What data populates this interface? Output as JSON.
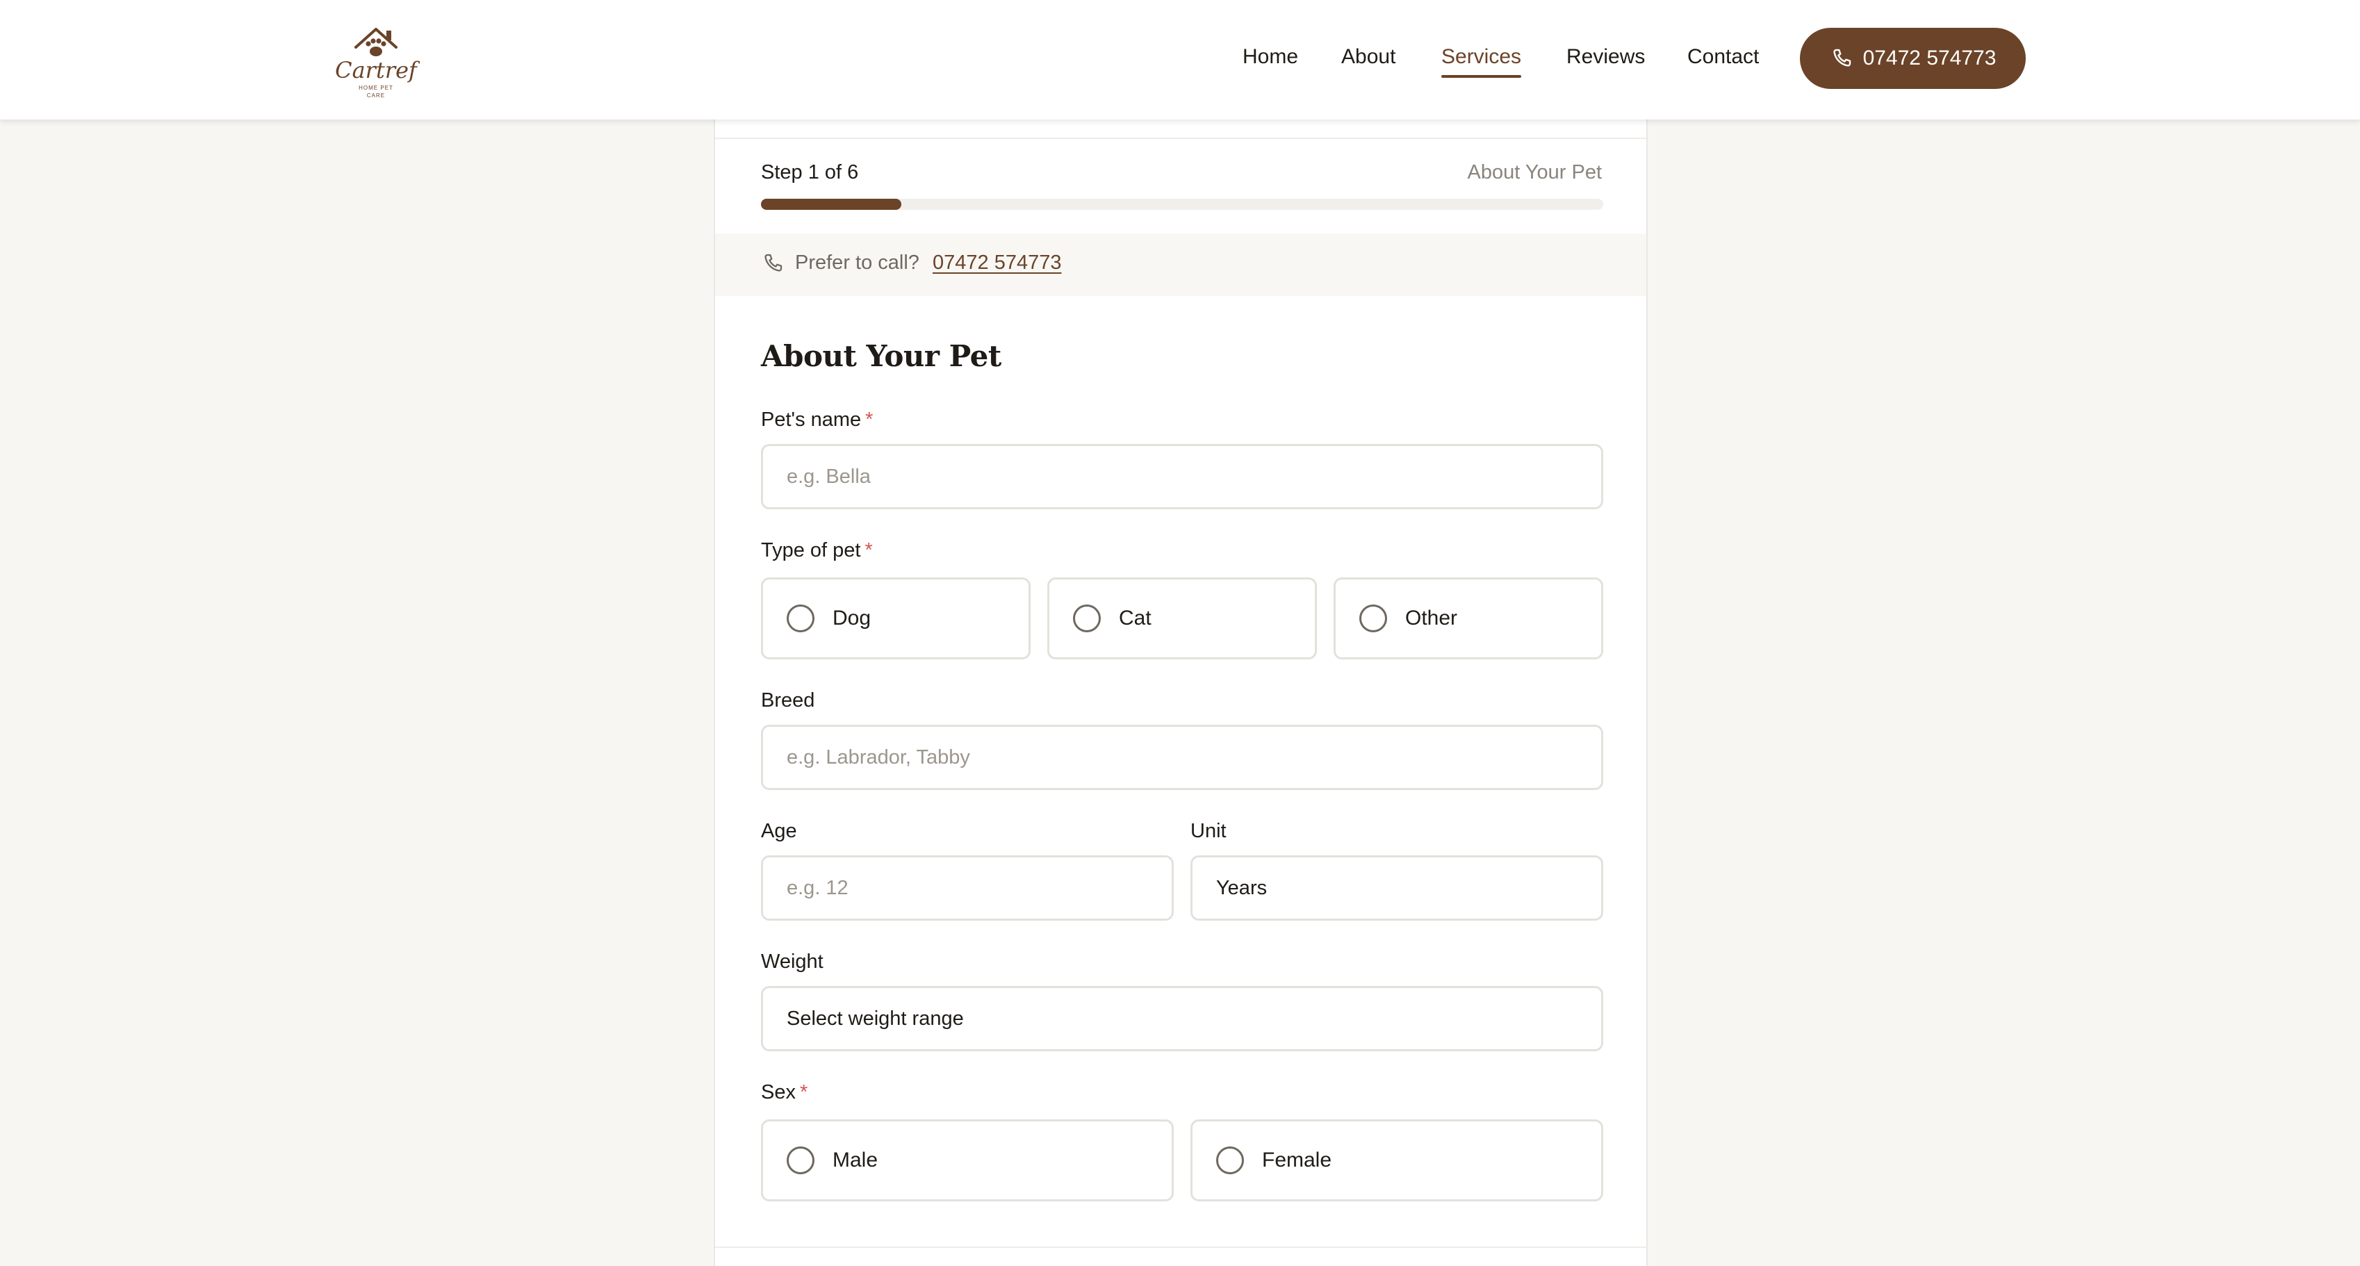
{
  "header": {
    "logo": {
      "name": "Cartref",
      "tagline_line1": "HOME PET",
      "tagline_line2": "CARE"
    },
    "nav": [
      {
        "label": "Home",
        "active": false
      },
      {
        "label": "About",
        "active": false
      },
      {
        "label": "Services",
        "active": true
      },
      {
        "label": "Reviews",
        "active": false
      },
      {
        "label": "Contact",
        "active": false
      }
    ],
    "phone_button": "07472 574773"
  },
  "progress": {
    "step_label": "Step 1 of 6",
    "step_title": "About Your Pet",
    "fraction": 0.1667
  },
  "call_strip": {
    "prompt": "Prefer to call?",
    "number": "07472 574773"
  },
  "form": {
    "title": "About Your Pet",
    "pet_name": {
      "label": "Pet's name",
      "required": "*",
      "placeholder": "e.g. Bella"
    },
    "pet_type": {
      "label": "Type of pet",
      "required": "*",
      "options": [
        "Dog",
        "Cat",
        "Other"
      ]
    },
    "breed": {
      "label": "Breed",
      "placeholder": "e.g. Labrador, Tabby"
    },
    "age": {
      "label": "Age",
      "placeholder": "e.g. 12"
    },
    "unit": {
      "label": "Unit",
      "value": "Years"
    },
    "weight": {
      "label": "Weight",
      "value": "Select weight range"
    },
    "sex": {
      "label": "Sex",
      "required": "*",
      "options": [
        "Male",
        "Female"
      ]
    }
  },
  "colors": {
    "brand": "#6b4328",
    "required": "#d9534f",
    "background": "#f7f6f3"
  }
}
